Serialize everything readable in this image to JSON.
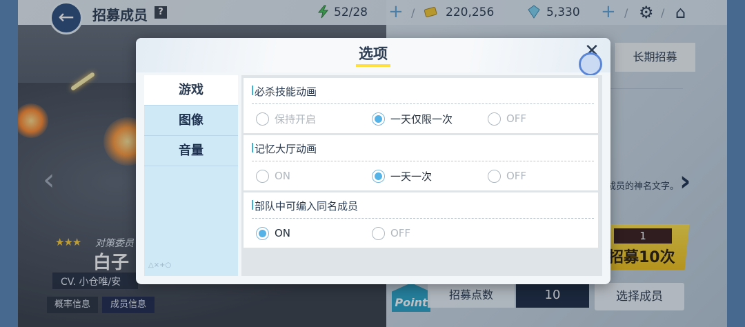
{
  "header": {
    "title": "招募成员",
    "help_label": "?",
    "back_icon": "back-arrow-icon",
    "stamina": "52/28",
    "credits": "220,256",
    "gems": "5,330",
    "plus": "+",
    "sep": "/"
  },
  "background": {
    "tab_long_recruit": "长期招募",
    "desc_text": "成员的神名文字。",
    "recruit_count": "1",
    "recruit_label": "招募10次",
    "point_badge": "Point",
    "point_label": "招募点数",
    "point_value": "10",
    "select_label": "选择成员",
    "stars": "★★★",
    "char_role": "对策委员",
    "char_name": "白子",
    "char_cv": "CV. 小仓唯/安",
    "rate_btn": "概率信息",
    "member_btn": "成员信息"
  },
  "modal": {
    "title": "选项",
    "close": "✕",
    "nav": [
      {
        "label": "游戏",
        "active": true
      },
      {
        "label": "图像",
        "active": false
      },
      {
        "label": "音量",
        "active": false
      }
    ],
    "nav_deco": "△×+○",
    "sections": [
      {
        "title": "必杀技能动画",
        "options": [
          {
            "label": "保持开启",
            "selected": false
          },
          {
            "label": "一天仅限一次",
            "selected": true
          },
          {
            "label": "OFF",
            "selected": false
          }
        ]
      },
      {
        "title": "记忆大厅动画",
        "options": [
          {
            "label": "ON",
            "selected": false
          },
          {
            "label": "一天一次",
            "selected": true
          },
          {
            "label": "OFF",
            "selected": false
          }
        ]
      },
      {
        "title": "部队中可编入同名成员",
        "options": [
          {
            "label": "ON",
            "selected": true
          },
          {
            "label": "OFF",
            "selected": false
          }
        ]
      }
    ]
  },
  "colors": {
    "accent": "#56b3e8",
    "nav_bg": "#cfe9f7",
    "title_underline": "#ffe040"
  }
}
